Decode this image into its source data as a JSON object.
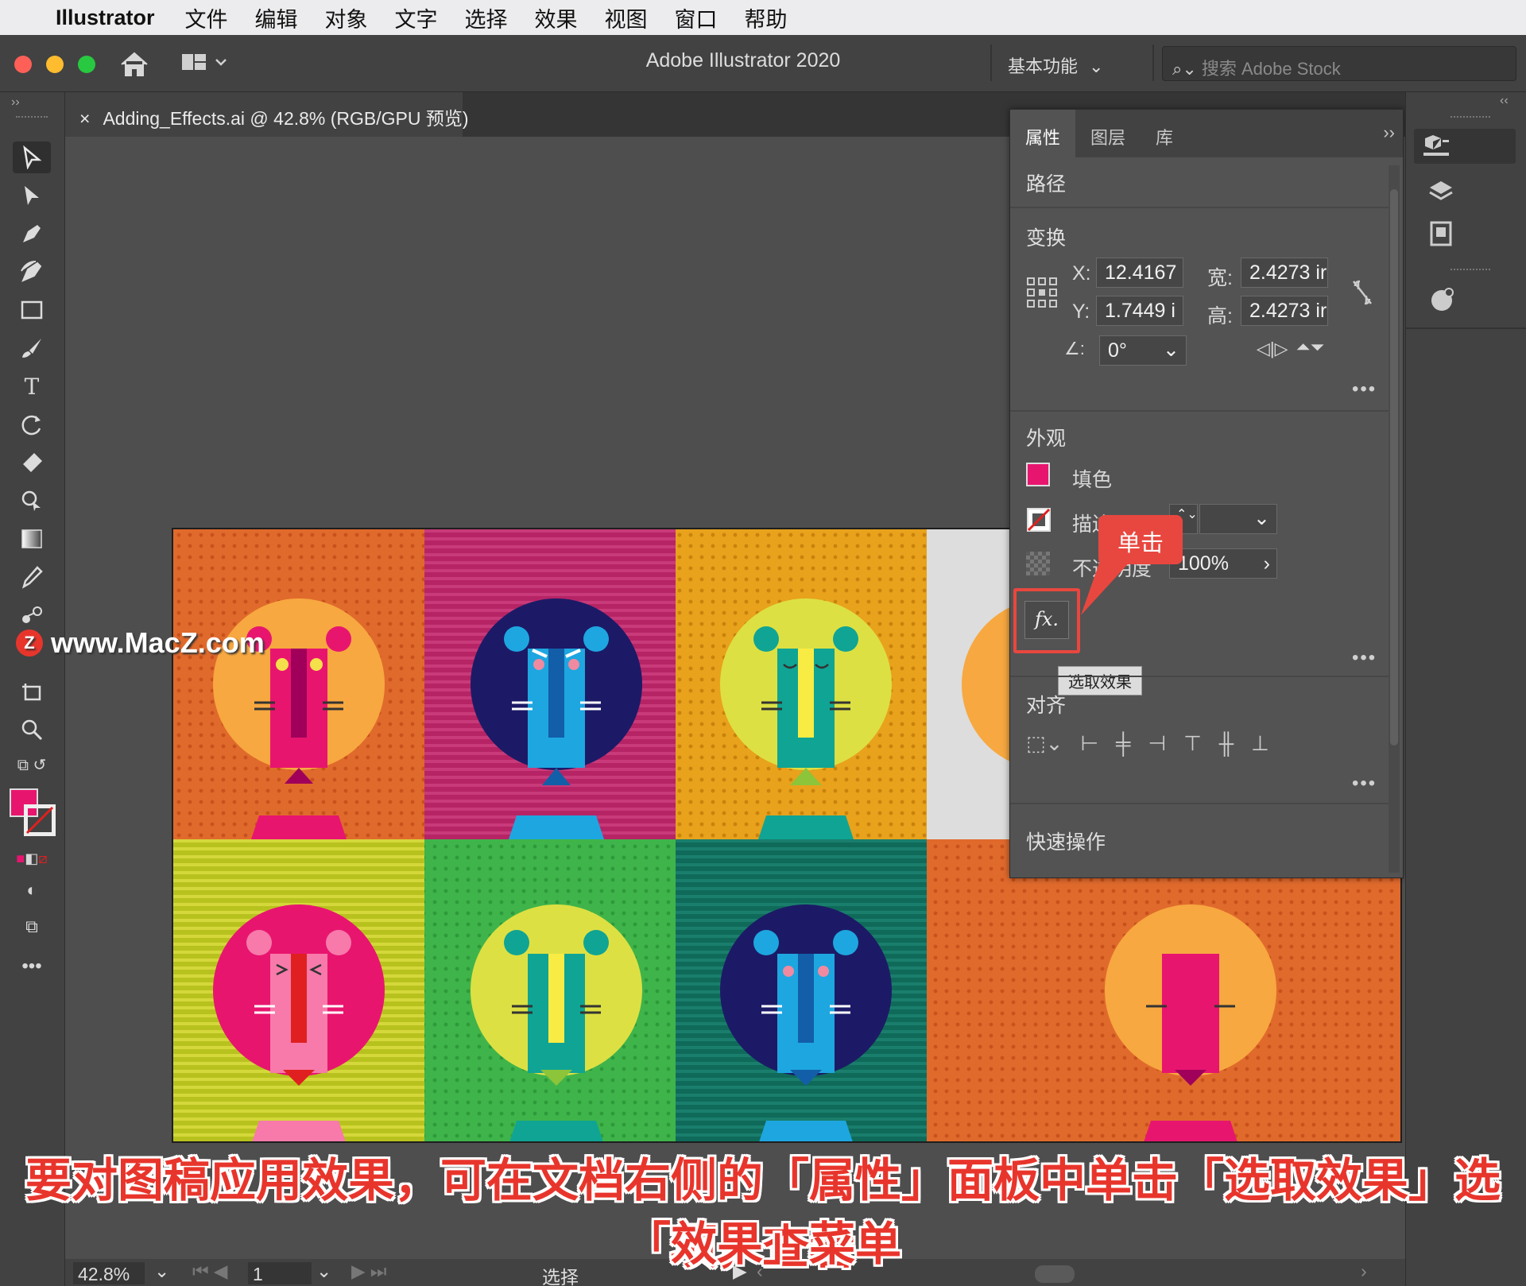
{
  "menubar": {
    "app_name": "Illustrator",
    "items": [
      "文件",
      "编辑",
      "对象",
      "文字",
      "选择",
      "效果",
      "视图",
      "窗口",
      "帮助"
    ]
  },
  "titlebar": {
    "title": "Adobe Illustrator 2020",
    "workspace": "基本功能",
    "search_placeholder": "搜索 Adobe Stock"
  },
  "document_tab": {
    "title": "Adding_Effects.ai @ 42.8% (RGB/GPU 预览)"
  },
  "properties_panel": {
    "tabs": [
      "属性",
      "图层",
      "库"
    ],
    "active_tab": "属性",
    "object_type": "路径",
    "transform": {
      "heading": "变换",
      "x_label": "X:",
      "x_value": "12.4167",
      "y_label": "Y:",
      "y_value": "1.7449 i",
      "w_label": "宽:",
      "w_value": "2.4273 ir",
      "h_label": "高:",
      "h_value": "2.4273 ir",
      "angle_value": "0°"
    },
    "appearance": {
      "heading": "外观",
      "fill_label": "填色",
      "stroke_label": "描边",
      "opacity_label": "不透明度",
      "opacity_value": "100%",
      "fill_color": "#e8156f"
    },
    "fx_tooltip": "选取效果",
    "align": {
      "heading": "对齐"
    },
    "quick_actions": {
      "heading": "快速操作"
    }
  },
  "callout": {
    "text": "单击"
  },
  "statusbar": {
    "zoom": "42.8%",
    "page": "1",
    "tool": "选择"
  },
  "watermark": {
    "text": "www.MacZ.com"
  },
  "caption": {
    "line1": "要对图稿应用效果，可在文档右侧的「属性」面板中单击「选取效果」选项，查看",
    "line2": "「效果」菜单"
  },
  "colors": {
    "accent_red": "#e8473f",
    "panel_bg": "#535353",
    "chrome_bg": "#424242"
  },
  "icons": {
    "tools": [
      "selection-icon",
      "direct-selection-icon",
      "pen-icon",
      "curvature-icon",
      "rectangle-icon",
      "paintbrush-icon",
      "type-icon",
      "rotate-icon",
      "eraser-icon",
      "shape-builder-icon",
      "gradient-icon",
      "eyedropper-icon",
      "blend-icon",
      "artboard-icon",
      "zoom-icon"
    ]
  }
}
